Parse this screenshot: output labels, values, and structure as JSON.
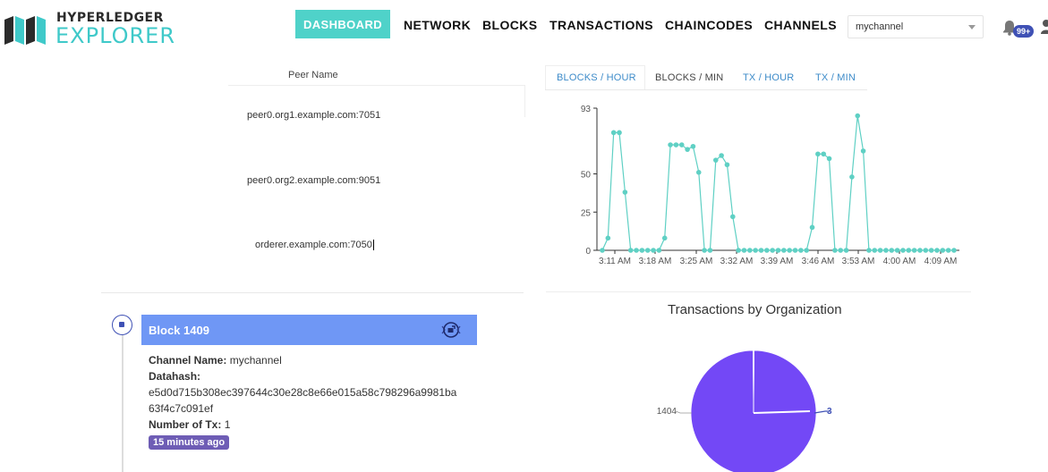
{
  "app": {
    "logo_line1": "HYPERLEDGER",
    "logo_line2": "EXPLORER"
  },
  "nav": {
    "items": [
      {
        "label": "DASHBOARD",
        "active": true
      },
      {
        "label": "NETWORK"
      },
      {
        "label": "BLOCKS"
      },
      {
        "label": "TRANSACTIONS"
      },
      {
        "label": "CHAINCODES"
      },
      {
        "label": "CHANNELS"
      }
    ],
    "channel_select": "mychannel",
    "notifications_badge": "99+"
  },
  "peers": {
    "header": "Peer Name",
    "rows": [
      "peer0.org1.example.com:7051",
      "peer0.org2.example.com:9051",
      "orderer.example.com:7050"
    ]
  },
  "chart_tabs": [
    {
      "label": "BLOCKS / HOUR"
    },
    {
      "label": "BLOCKS / MIN",
      "active": true
    },
    {
      "label": "TX / HOUR"
    },
    {
      "label": "TX / MIN"
    }
  ],
  "chart_data": [
    {
      "type": "line",
      "ylim": [
        0,
        93
      ],
      "yticks": [
        "0",
        "25",
        "50",
        "93"
      ],
      "xticks": [
        "3:11 AM",
        "3:18 AM",
        "3:25 AM",
        "3:32 AM",
        "3:39 AM",
        "3:46 AM",
        "3:53 AM",
        "4:00 AM",
        "4:09 AM"
      ],
      "color": "#5fd0c4",
      "values": [
        0,
        8,
        77,
        77,
        38,
        0,
        0,
        0,
        0,
        0,
        0,
        8,
        69,
        69,
        69,
        66,
        68,
        51,
        0,
        0,
        59,
        62,
        56,
        22,
        0,
        0,
        0,
        0,
        0,
        0,
        0,
        0,
        0,
        0,
        0,
        0,
        0,
        15,
        63,
        63,
        60,
        0,
        0,
        0,
        48,
        88,
        65,
        0,
        0,
        0,
        0,
        0,
        0,
        0,
        0,
        0,
        0,
        0,
        0,
        0,
        0,
        0,
        0
      ]
    },
    {
      "type": "pie",
      "title": "Transactions by Organization",
      "slices": [
        {
          "label": "1404",
          "value": 1404,
          "color": "#7348f6"
        },
        {
          "label": "3",
          "value": 3,
          "color": "#3f51b5"
        }
      ]
    }
  ],
  "block": {
    "title": "Block 1409",
    "channel_label": "Channel Name:",
    "channel_value": "mychannel",
    "datahash_label": "Datahash:",
    "datahash_line1": "e5d0d715b308ec397644c30e28c8e66e015a58c798296a9981ba",
    "datahash_line2": "63f4c7c091ef",
    "tx_label": "Number of Tx:",
    "tx_value": "1",
    "time_ago": "15 minutes ago"
  }
}
